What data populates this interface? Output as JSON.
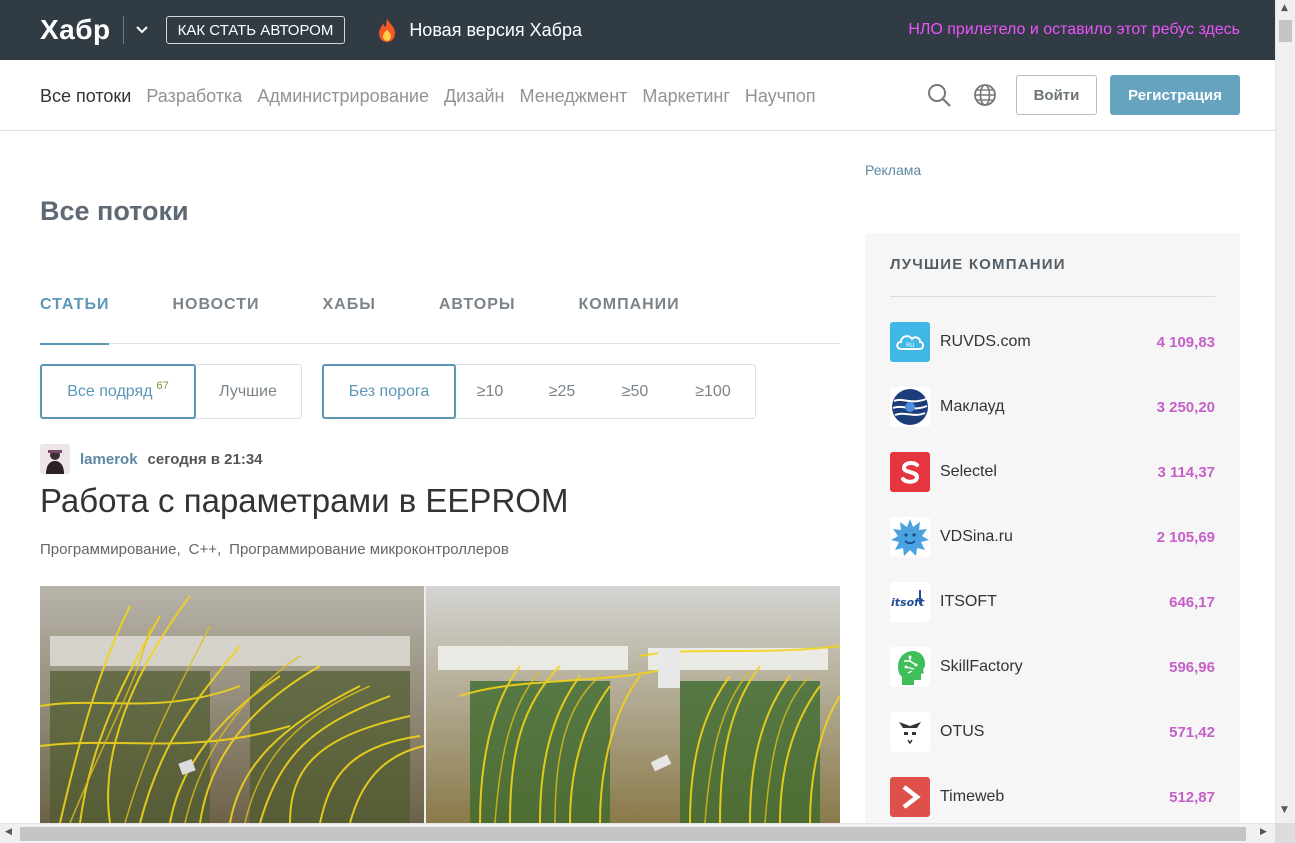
{
  "topbar": {
    "logo": "Хабр",
    "author_button": "КАК СТАТЬ АВТОРОМ",
    "new_version": "Новая версия Хабра",
    "ufo_text": "НЛО прилетело и оставило этот ребус здесь"
  },
  "nav": {
    "links": [
      "Все потоки",
      "Разработка",
      "Администрирование",
      "Дизайн",
      "Менеджмент",
      "Маркетинг",
      "Научпоп"
    ],
    "login": "Войти",
    "register": "Регистрация"
  },
  "main": {
    "title": "Все потоки",
    "tabs": [
      "СТАТЬИ",
      "НОВОСТИ",
      "ХАБЫ",
      "АВТОРЫ",
      "КОМПАНИИ"
    ],
    "filter_type": [
      {
        "label": "Все подряд",
        "count": "67"
      },
      {
        "label": "Лучшие"
      }
    ],
    "filter_threshold": [
      "Без порога",
      "≥10",
      "≥25",
      "≥50",
      "≥100"
    ]
  },
  "post": {
    "author": "lamerok",
    "time": "сегодня в 21:34",
    "title": "Работа с параметрами в EEPROM",
    "hubs": [
      "Программирование,",
      "C++,",
      "Программирование микроконтроллеров"
    ]
  },
  "sidebar": {
    "ad_label": "Реклама",
    "title": "ЛУЧШИЕ КОМПАНИИ",
    "companies": [
      {
        "name": "RUVDS.com",
        "rating": "4 109,83",
        "logo": "ruvds-cloud-icon",
        "color": "#3fb8e5"
      },
      {
        "name": "Маклауд",
        "rating": "3 250,20",
        "logo": "macloud-globe-icon",
        "color": "#1c3d7a"
      },
      {
        "name": "Selectel",
        "rating": "3 114,37",
        "logo": "selectel-s-icon",
        "color": "#e5353f"
      },
      {
        "name": "VDSina.ru",
        "rating": "2 105,69",
        "logo": "vdsina-sun-icon",
        "color": "#4aa3e0"
      },
      {
        "name": "ITSOFT",
        "rating": "646,17",
        "logo": "itsoft-wordmark-icon",
        "color": "#1f4f9a"
      },
      {
        "name": "SkillFactory",
        "rating": "596,96",
        "logo": "skillfactory-head-icon",
        "color": "#3fbf5a"
      },
      {
        "name": "OTUS",
        "rating": "571,42",
        "logo": "otus-owl-icon",
        "color": "#333333"
      },
      {
        "name": "Timeweb",
        "rating": "512,87",
        "logo": "timeweb-arrow-icon",
        "color": "#e0504a"
      }
    ]
  }
}
